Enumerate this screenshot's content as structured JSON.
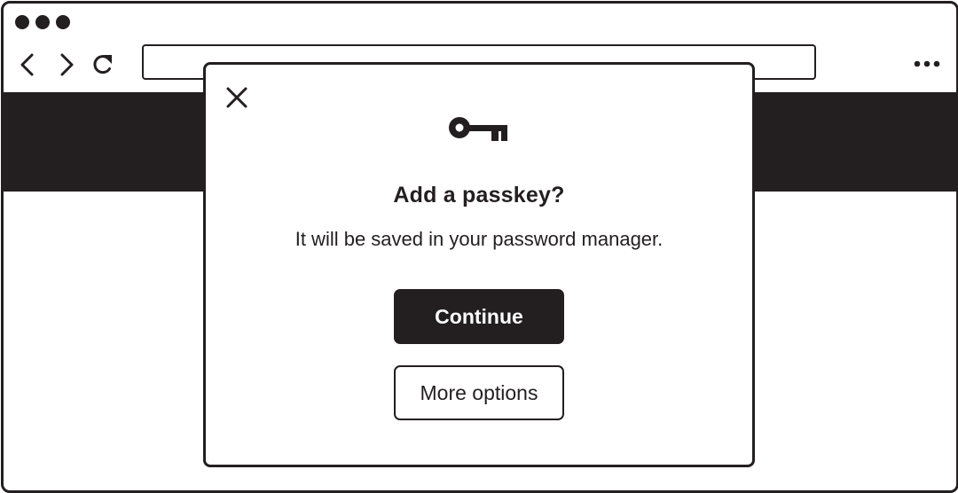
{
  "window": {
    "traffic_lights": [
      "window-dot",
      "window-dot",
      "window-dot"
    ]
  },
  "toolbar": {
    "back_icon": "chevron-left-icon",
    "forward_icon": "chevron-right-icon",
    "reload_icon": "reload-icon",
    "address_value": "",
    "menu_icon": "more-horizontal-icon"
  },
  "dialog": {
    "close_icon": "close-icon",
    "icon": "key-icon",
    "title": "Add a passkey?",
    "subtitle": "It will be saved in your password manager.",
    "primary_button": "Continue",
    "secondary_button": "More options"
  },
  "colors": {
    "ink": "#231f20",
    "background": "#ffffff"
  }
}
